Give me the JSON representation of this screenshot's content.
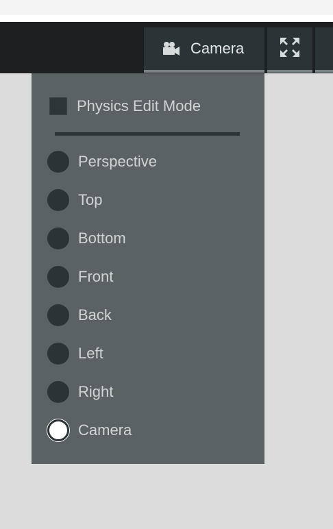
{
  "toolbar": {
    "camera_button_label": "Camera",
    "camera_icon": "video-camera-icon",
    "fullscreen_icon": "fullscreen-icon"
  },
  "menu": {
    "physics_edit_mode_label": "Physics Edit Mode",
    "physics_edit_mode_checked": false,
    "view_options": [
      {
        "label": "Perspective",
        "selected": false
      },
      {
        "label": "Top",
        "selected": false
      },
      {
        "label": "Bottom",
        "selected": false
      },
      {
        "label": "Front",
        "selected": false
      },
      {
        "label": "Back",
        "selected": false
      },
      {
        "label": "Left",
        "selected": false
      },
      {
        "label": "Right",
        "selected": false
      },
      {
        "label": "Camera",
        "selected": true
      }
    ]
  },
  "colors": {
    "toolbar_bg": "#1e1f20",
    "button_bg": "#2a3336",
    "panel_bg": "#5b6263",
    "page_bg": "#dcdcdc"
  }
}
